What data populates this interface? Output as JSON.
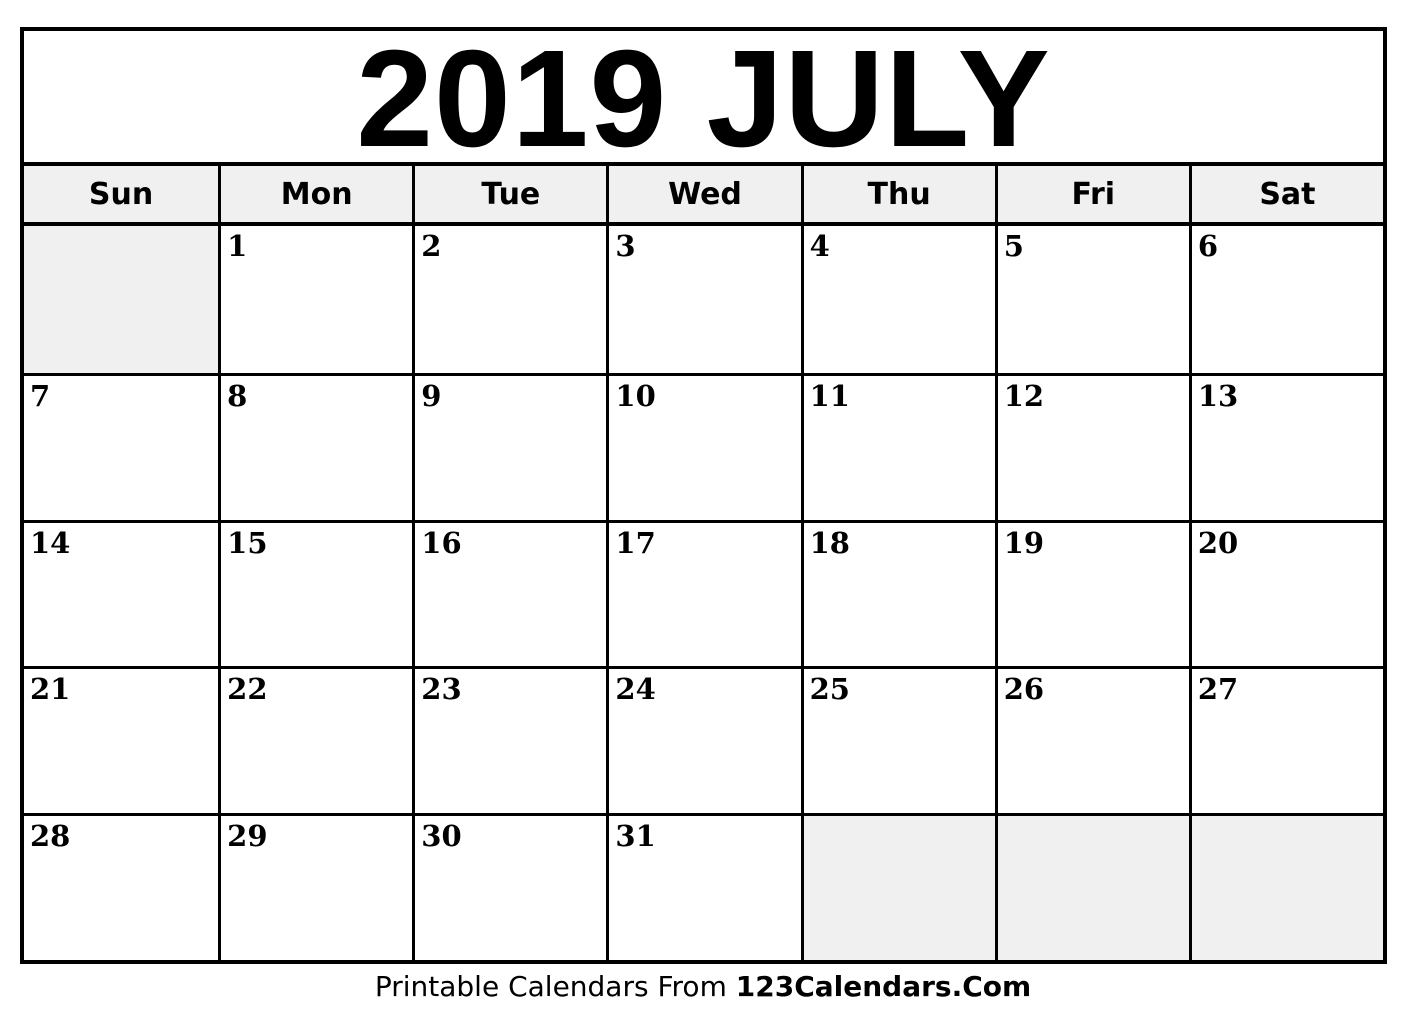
{
  "calendar": {
    "title": "2019 JULY",
    "year": 2019,
    "month": "JULY",
    "weekdays": [
      "Sun",
      "Mon",
      "Tue",
      "Wed",
      "Thu",
      "Fri",
      "Sat"
    ],
    "weeks": [
      [
        "",
        "1",
        "2",
        "3",
        "4",
        "5",
        "6"
      ],
      [
        "7",
        "8",
        "9",
        "10",
        "11",
        "12",
        "13"
      ],
      [
        "14",
        "15",
        "16",
        "17",
        "18",
        "19",
        "20"
      ],
      [
        "21",
        "22",
        "23",
        "24",
        "25",
        "26",
        "27"
      ],
      [
        "28",
        "29",
        "30",
        "31",
        "",
        "",
        ""
      ]
    ]
  },
  "footer": {
    "prefix": "Printable Calendars From ",
    "brand": "123Calendars.Com"
  },
  "colors": {
    "border": "#000000",
    "header_fill": "#f0f0f0",
    "empty_cell_fill": "#f0f0f0",
    "cell_fill": "#ffffff"
  }
}
